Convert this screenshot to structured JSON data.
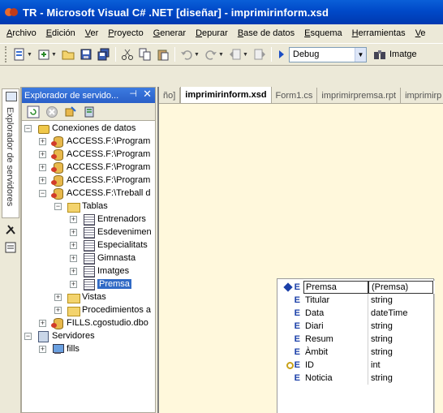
{
  "window": {
    "title": "TR - Microsoft Visual C# .NET [diseñar] - imprimirinform.xsd"
  },
  "menu": [
    {
      "label": "Archivo",
      "u": "A",
      "rest": "rchivo"
    },
    {
      "label": "Edición",
      "u": "E",
      "rest": "dición"
    },
    {
      "label": "Ver",
      "u": "V",
      "rest": "er"
    },
    {
      "label": "Proyecto",
      "u": "P",
      "rest": "royecto"
    },
    {
      "label": "Generar",
      "u": "G",
      "rest": "enerar"
    },
    {
      "label": "Depurar",
      "u": "D",
      "rest": "epurar"
    },
    {
      "label": "Base de datos",
      "u": "B",
      "rest": "ase de datos"
    },
    {
      "label": "Esquema",
      "u": "E",
      "rest": "squema"
    },
    {
      "label": "Herramientas",
      "u": "H",
      "rest": "erramientas"
    },
    {
      "label": "Ve",
      "u": "V",
      "rest": "e"
    }
  ],
  "toolbar": {
    "config_value": "Debug",
    "image_label": "Imatge"
  },
  "side_strip": {
    "vertical_label": "Explorador de servidores"
  },
  "panel": {
    "title": "Explorador de servido...",
    "pin_glyph": "⊣",
    "close_glyph": "✕"
  },
  "tree": {
    "root": "Conexiones de datos",
    "connections": [
      "ACCESS.F:\\Program",
      "ACCESS.F:\\Program",
      "ACCESS.F:\\Program",
      "ACCESS.F:\\Program",
      "ACCESS.F:\\Treball d"
    ],
    "tables_label": "Tablas",
    "tables": [
      "Entrenadors",
      "Esdevenimen",
      "Especialitats",
      "Gimnasta",
      "Imatges",
      "Premsa"
    ],
    "selected_table": "Premsa",
    "views_label": "Vistas",
    "procs_label": "Procedimientos a",
    "fills_conn": "FILLS.cgostudio.dbo",
    "servers_label": "Servidores",
    "server_name": "fills"
  },
  "tabs": [
    "ño]",
    "imprimirinform.xsd",
    "Form1.cs",
    "imprimirpremsa.rpt",
    "imprimirp"
  ],
  "active_tab": "imprimirinform.xsd",
  "schema": {
    "element_name": "Premsa",
    "element_type": "(Premsa)",
    "fields": [
      {
        "name": "Titular",
        "type": "string",
        "key": false
      },
      {
        "name": "Data",
        "type": "dateTime",
        "key": false
      },
      {
        "name": "Diari",
        "type": "string",
        "key": false
      },
      {
        "name": "Resum",
        "type": "string",
        "key": false
      },
      {
        "name": "Àmbit",
        "type": "string",
        "key": false
      },
      {
        "name": "ID",
        "type": "int",
        "key": true
      },
      {
        "name": "Noticia",
        "type": "string",
        "key": false
      }
    ],
    "element_marker": "E"
  }
}
